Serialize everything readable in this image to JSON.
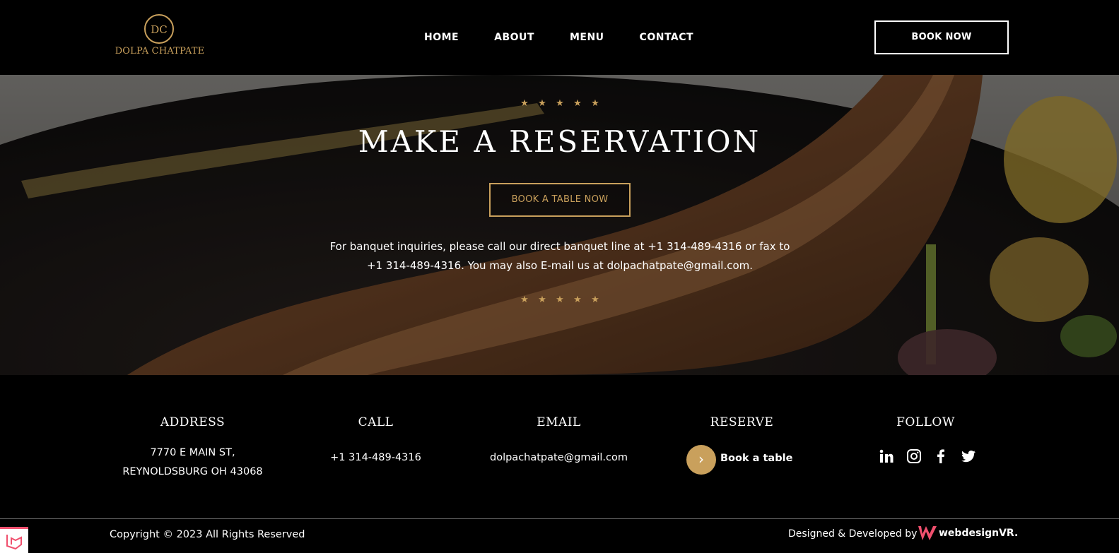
{
  "header": {
    "logo_monogram": "DC",
    "logo_text": "DOLPA CHATPATE",
    "nav": [
      {
        "label": "HOME"
      },
      {
        "label": "ABOUT"
      },
      {
        "label": "MENU"
      },
      {
        "label": "CONTACT"
      }
    ],
    "book_now": "BOOK NOW"
  },
  "hero": {
    "stars_top": [
      "★",
      "★",
      "★",
      "★",
      "★"
    ],
    "title": "MAKE A RESERVATION",
    "book_table": "BOOK A TABLE NOW",
    "text": "For banquet inquiries, please call our direct banquet line at +1 314-489-4316 or fax to +1 314-489-4316. You may also E-mail us at dolpachatpate@gmail.com.",
    "stars_bottom": [
      "★",
      "★",
      "★",
      "★",
      "★"
    ]
  },
  "footer": {
    "address": {
      "title": "ADDRESS",
      "line1": "7770 E MAIN ST,",
      "line2": "REYNOLDSBURG OH 43068"
    },
    "call": {
      "title": "CALL",
      "phone": "+1 314-489-4316"
    },
    "email": {
      "title": "EMAIL",
      "address": "dolpachatpate@gmail.com"
    },
    "reserve": {
      "title": "RESERVE",
      "arrow": "›",
      "label": "Book a table"
    },
    "follow": {
      "title": "FOLLOW",
      "icons": [
        "linkedin-icon",
        "instagram-icon",
        "facebook-icon",
        "twitter-icon"
      ]
    }
  },
  "bottom": {
    "copyright": "Copyright © 2023 All Rights Reserved",
    "credit": "Designed & Developed by",
    "brand": "webdesignVR."
  },
  "colors": {
    "accent_gold": "#c9a05c",
    "background": "#000000",
    "text": "#ffffff",
    "brand_pink": "#f0506e"
  }
}
